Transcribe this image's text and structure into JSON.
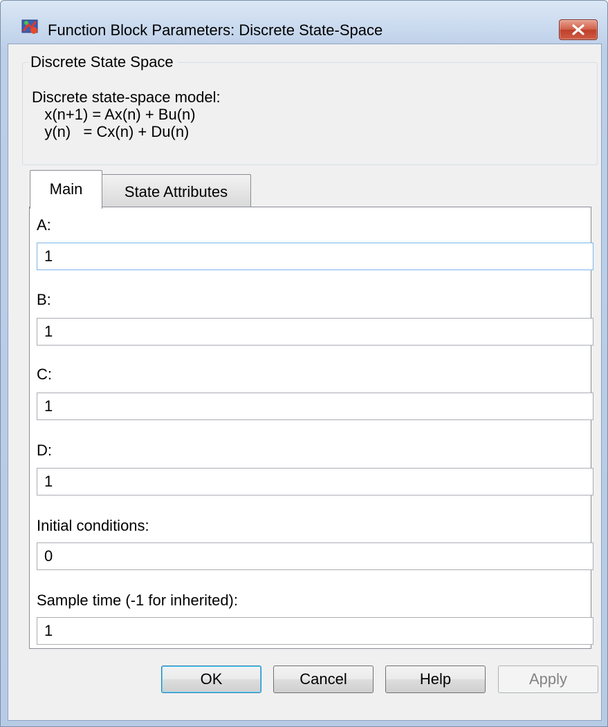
{
  "window": {
    "title": "Function Block Parameters: Discrete State-Space",
    "icon": "simulink-block-icon",
    "close_icon": "close-icon"
  },
  "block": {
    "group_title": "Discrete State Space",
    "description": [
      "Discrete state-space model:",
      "   x(n+1) = Ax(n) + Bu(n)",
      "   y(n)   = Cx(n) + Du(n)"
    ]
  },
  "tabs": [
    {
      "label": "Main",
      "selected": true
    },
    {
      "label": "State Attributes",
      "selected": false
    }
  ],
  "fields": [
    {
      "label": "A:",
      "value": "1"
    },
    {
      "label": "B:",
      "value": "1"
    },
    {
      "label": "C:",
      "value": "1"
    },
    {
      "label": "D:",
      "value": "1"
    },
    {
      "label": "Initial conditions:",
      "value": "0"
    },
    {
      "label": "Sample time (-1 for inherited):",
      "value": "1"
    }
  ],
  "buttons": {
    "ok": "OK",
    "cancel": "Cancel",
    "help": "Help",
    "apply": "Apply"
  },
  "colors": {
    "close_button": "#c9452f",
    "focus_border": "#7eb4ea",
    "default_button_border": "#3c7fb1"
  }
}
